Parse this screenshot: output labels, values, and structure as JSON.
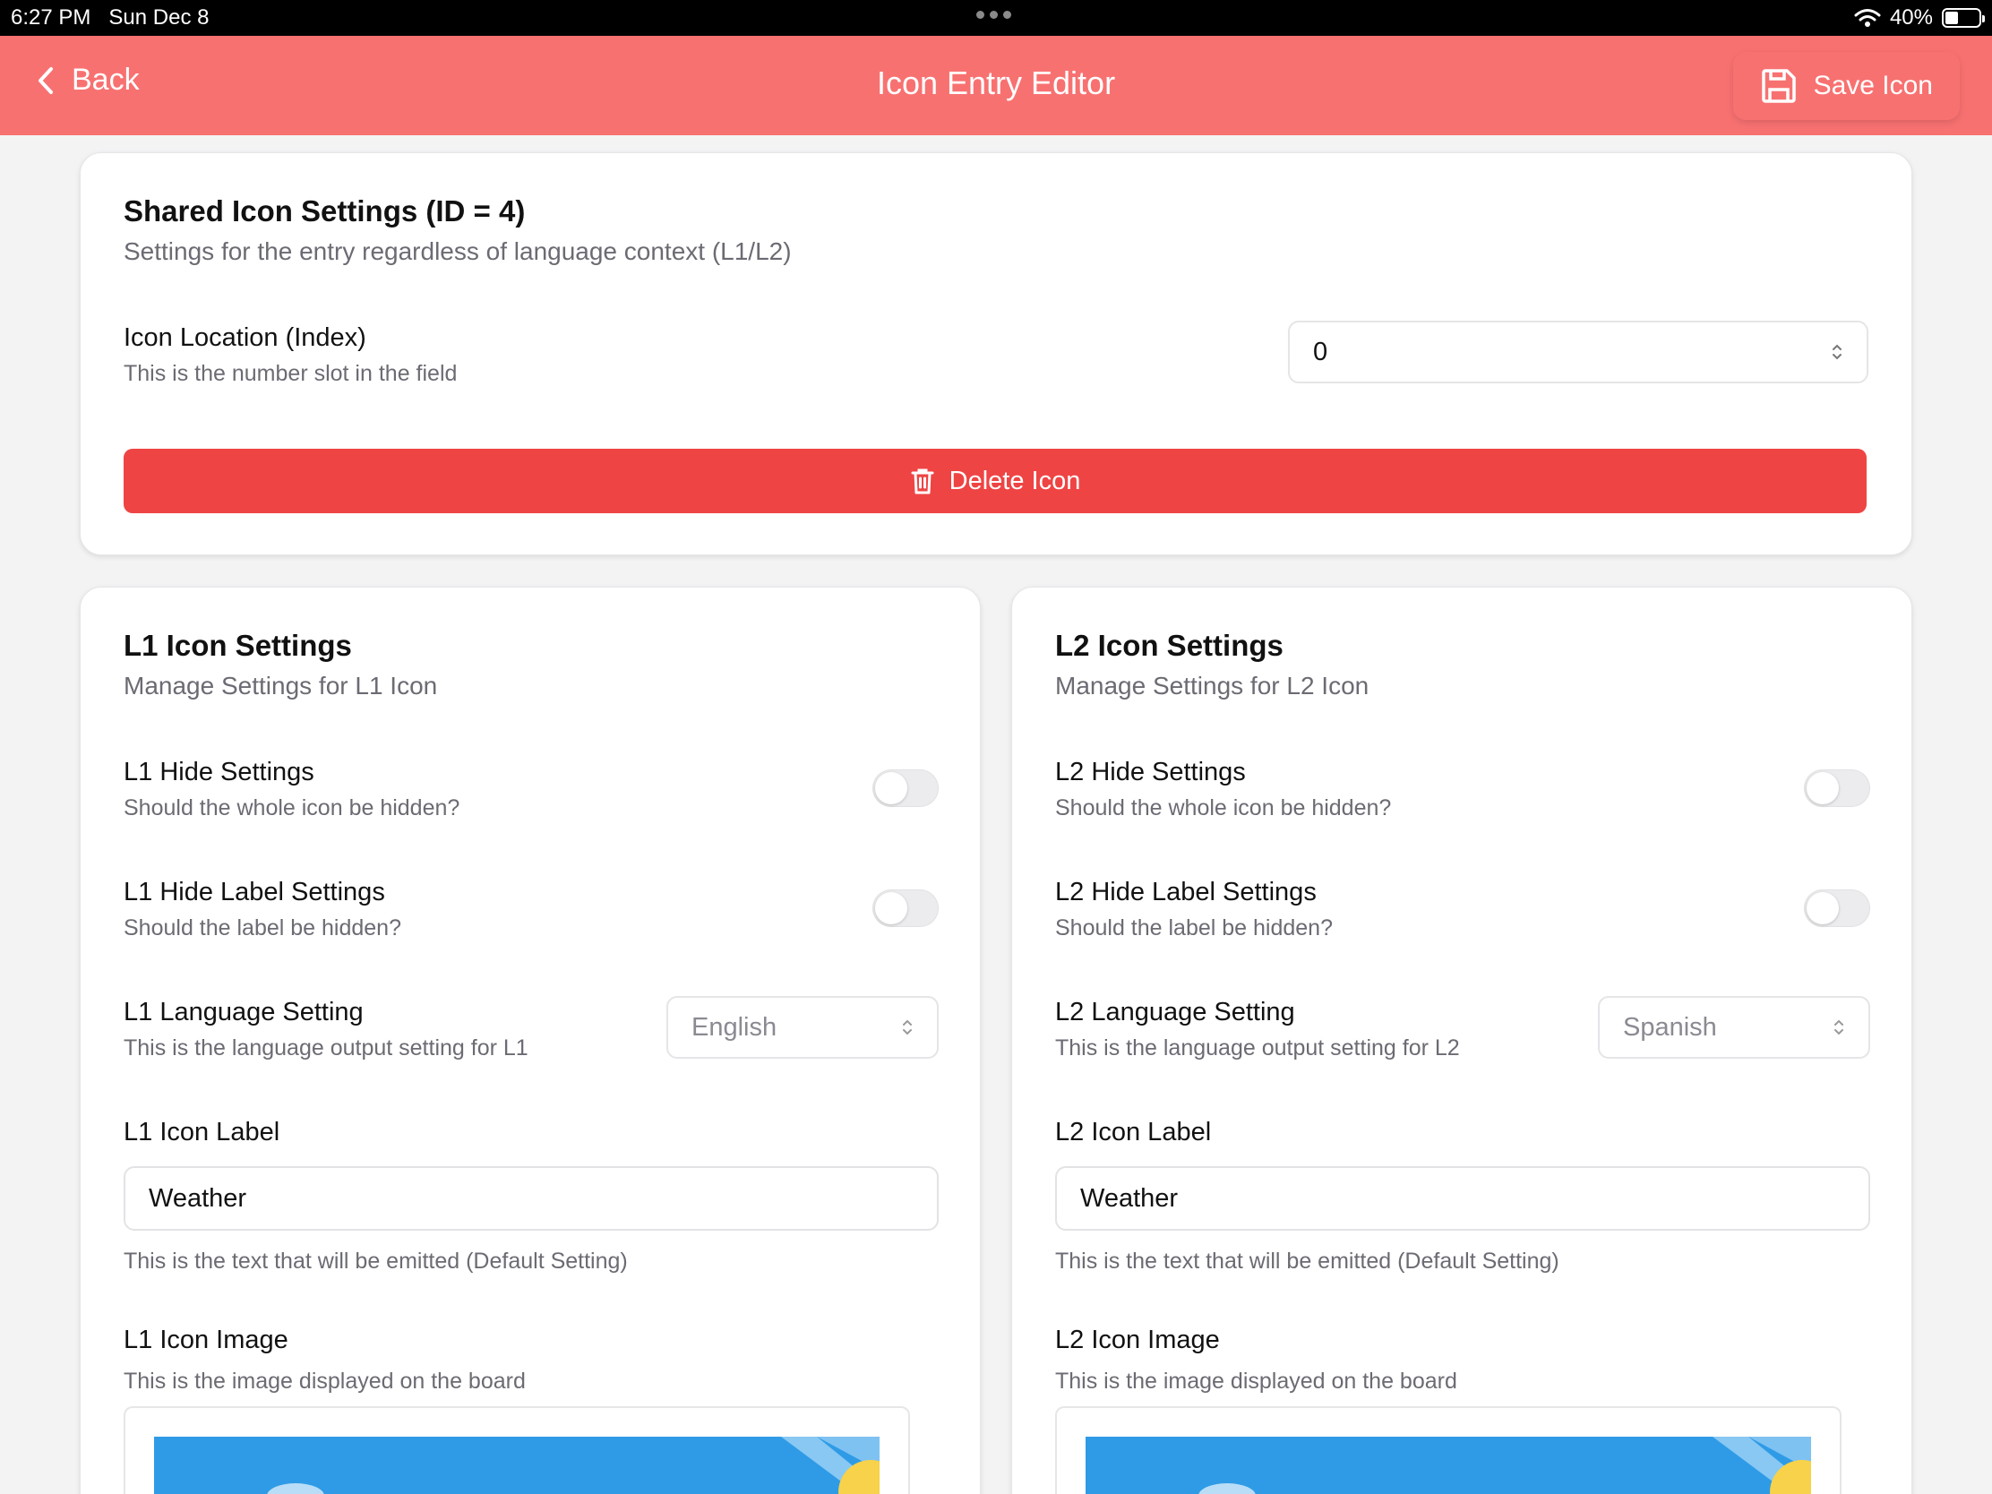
{
  "status_bar": {
    "time": "6:27 PM",
    "date": "Sun Dec 8",
    "battery": "40%",
    "battery_level": 0.4
  },
  "header": {
    "back_label": "Back",
    "title": "Icon Entry Editor",
    "save_label": "Save Icon"
  },
  "shared": {
    "title": "Shared Icon Settings (ID = 4)",
    "subtitle": "Settings for the entry regardless of language context (L1/L2)",
    "location_label": "Icon Location (Index)",
    "location_desc": "This is the number slot in the field",
    "location_value": "0",
    "delete_label": "Delete Icon"
  },
  "l1": {
    "title": "L1 Icon Settings",
    "subtitle": "Manage Settings for L1 Icon",
    "hide_label": "L1 Hide Settings",
    "hide_desc": "Should the whole icon be hidden?",
    "hide_on": false,
    "hide_label_label": "L1 Hide Label Settings",
    "hide_label_desc": "Should the label be hidden?",
    "hide_label_on": false,
    "language_label": "L1 Language Setting",
    "language_desc": "This is the language output setting for L1",
    "language_value": "English",
    "icon_label_label": "L1 Icon Label",
    "icon_label_value": "Weather",
    "icon_label_desc": "This is the text that will be emitted (Default Setting)",
    "image_label": "L1 Icon Image",
    "image_desc": "This is the image displayed on the board"
  },
  "l2": {
    "title": "L2 Icon Settings",
    "subtitle": "Manage Settings for L2 Icon",
    "hide_label": "L2 Hide Settings",
    "hide_desc": "Should the whole icon be hidden?",
    "hide_on": false,
    "hide_label_label": "L2 Hide Label Settings",
    "hide_label_desc": "Should the label be hidden?",
    "hide_label_on": false,
    "language_label": "L2 Language Setting",
    "language_desc": "This is the language output setting for L2",
    "language_value": "Spanish",
    "icon_label_label": "L2 Icon Label",
    "icon_label_value": "Weather",
    "icon_label_desc": "This is the text that will be emitted (Default Setting)",
    "image_label": "L2 Icon Image",
    "image_desc": "This is the image displayed on the board"
  },
  "colors": {
    "header": "#f87171",
    "danger": "#ef4444",
    "sky": "#2f9be6",
    "sun": "#f7d24a"
  },
  "icons": {
    "back": "chevron-left-icon",
    "save": "save-icon",
    "delete": "trash-icon",
    "wifi": "wifi-icon",
    "battery": "battery-icon",
    "select": "chevron-up-down-icon"
  }
}
